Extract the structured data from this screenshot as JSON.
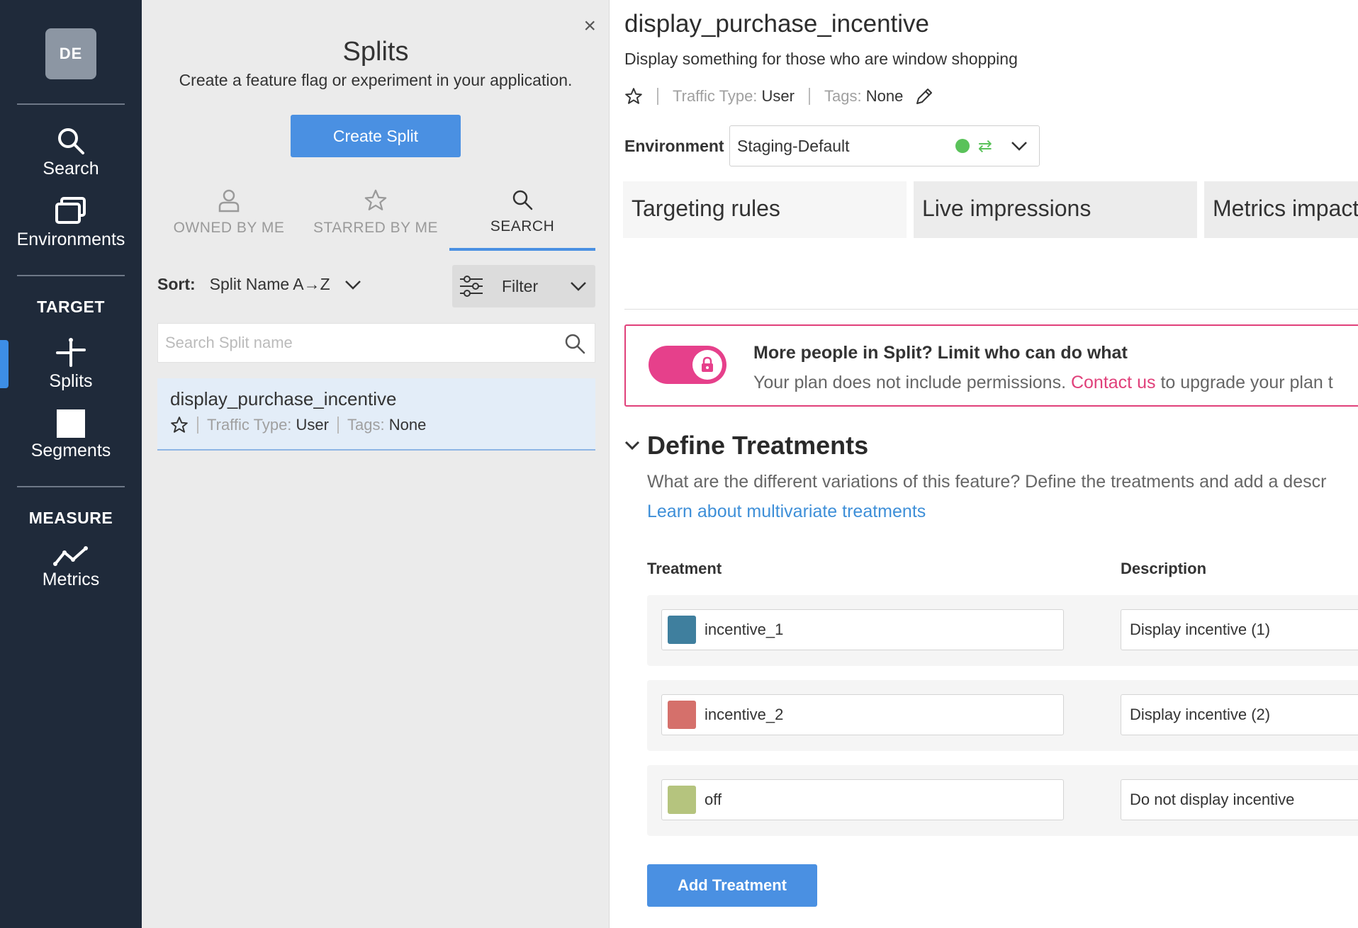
{
  "nav": {
    "avatar": "DE",
    "search": "Search",
    "environments": "Environments",
    "target_section": "TARGET",
    "splits": "Splits",
    "segments": "Segments",
    "measure_section": "MEASURE",
    "metrics": "Metrics"
  },
  "list": {
    "close": "×",
    "title": "Splits",
    "subtitle": "Create a feature flag or experiment in your application.",
    "create_button": "Create Split",
    "tabs": [
      "OWNED BY ME",
      "STARRED BY ME",
      "SEARCH"
    ],
    "active_tab": "SEARCH",
    "sort_label": "Sort:",
    "sort_value": "Split Name A→Z",
    "filter_label": "Filter",
    "search_placeholder": "Search Split name",
    "items": [
      {
        "name": "display_purchase_incentive",
        "traffic_label": "Traffic Type:",
        "traffic_value": "User",
        "tags_label": "Tags:",
        "tags_value": "None"
      }
    ]
  },
  "detail": {
    "title": "display_purchase_incentive",
    "description": "Display something for those who are window shopping",
    "traffic_label": "Traffic Type:",
    "traffic_value": "User",
    "tags_label": "Tags:",
    "tags_value": "None",
    "environment_label": "Environment",
    "environment_value": "Staging-Default",
    "tabs": [
      "Targeting rules",
      "Live impressions",
      "Metrics impact"
    ],
    "active_tab": "Targeting rules",
    "banner": {
      "title": "More people in Split? Limit who can do what",
      "text_before": "Your plan does not include permissions.",
      "link": "Contact us",
      "text_after": "to upgrade your plan t"
    },
    "section_title": "Define Treatments",
    "section_desc": "What are the different variations of this feature? Define the treatments and add a descr",
    "section_link": "Learn about multivariate treatments",
    "col_treatment": "Treatment",
    "col_description": "Description",
    "treatments": [
      {
        "name": "incentive_1",
        "description": "Display incentive (1)",
        "color": "#3f7f9e"
      },
      {
        "name": "incentive_2",
        "description": "Display incentive (2)",
        "color": "#d5706b"
      },
      {
        "name": "off",
        "description": "Do not display incentive",
        "color": "#b5c47e"
      }
    ],
    "add_button": "Add Treatment"
  },
  "colors": {
    "nav_bg": "#1f2a3a",
    "accent": "#4a90e2",
    "banner_accent": "#e0407a",
    "env_status": "#5ac25a"
  }
}
